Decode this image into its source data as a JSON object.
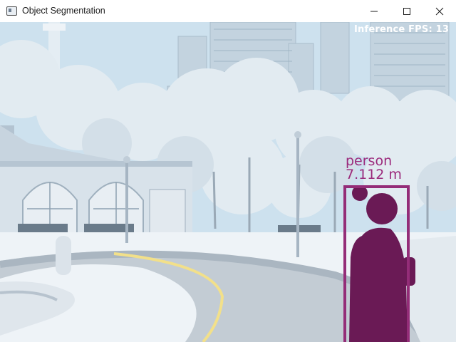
{
  "window": {
    "title": "Object Segmentation",
    "minimize_glyph": "—",
    "maximize_glyph": "☐",
    "close_glyph": "✕",
    "icon": "app-window-icon"
  },
  "overlay": {
    "fps_text": "Inference FPS: 13"
  },
  "detection": {
    "class_label": "person",
    "distance_label": "7.112 m",
    "box_color": "#942d78"
  },
  "colors": {
    "mask": "#6a1a55",
    "road_line": "#f2e08a"
  }
}
